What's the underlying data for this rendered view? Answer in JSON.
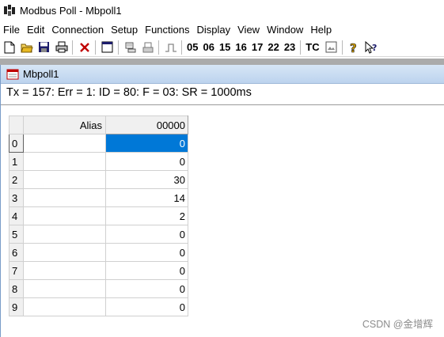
{
  "window": {
    "title": "Modbus Poll - Mbpoll1"
  },
  "menu": [
    "File",
    "Edit",
    "Connection",
    "Setup",
    "Functions",
    "Display",
    "View",
    "Window",
    "Help"
  ],
  "toolbar": {
    "icons": [
      "new-icon",
      "open-icon",
      "save-icon",
      "print-icon",
      "delete-icon",
      "window-icon",
      "comm-icon",
      "printer-log-icon",
      "pulse-icon",
      "help-icon",
      "context-help-icon"
    ],
    "codes": [
      "05",
      "06",
      "15",
      "16",
      "17",
      "22",
      "23"
    ],
    "tc": "TC"
  },
  "child": {
    "title": "Mbpoll1",
    "status": "Tx = 157: Err = 1: ID = 80: F = 03: SR = 1000ms"
  },
  "grid": {
    "headers": {
      "alias": "Alias",
      "value": "00000"
    },
    "rows": [
      {
        "index": "0",
        "alias": "",
        "value": "0"
      },
      {
        "index": "1",
        "alias": "",
        "value": "0"
      },
      {
        "index": "2",
        "alias": "",
        "value": "30"
      },
      {
        "index": "3",
        "alias": "",
        "value": "14"
      },
      {
        "index": "4",
        "alias": "",
        "value": "2"
      },
      {
        "index": "5",
        "alias": "",
        "value": "0"
      },
      {
        "index": "6",
        "alias": "",
        "value": "0"
      },
      {
        "index": "7",
        "alias": "",
        "value": "0"
      },
      {
        "index": "8",
        "alias": "",
        "value": "0"
      },
      {
        "index": "9",
        "alias": "",
        "value": "0"
      }
    ],
    "selected_row": 0
  },
  "watermark": "CSDN @金增辉",
  "colors": {
    "selection": "#0078d7",
    "mdi_background": "#ababab",
    "child_title": "#bcd3ee"
  }
}
